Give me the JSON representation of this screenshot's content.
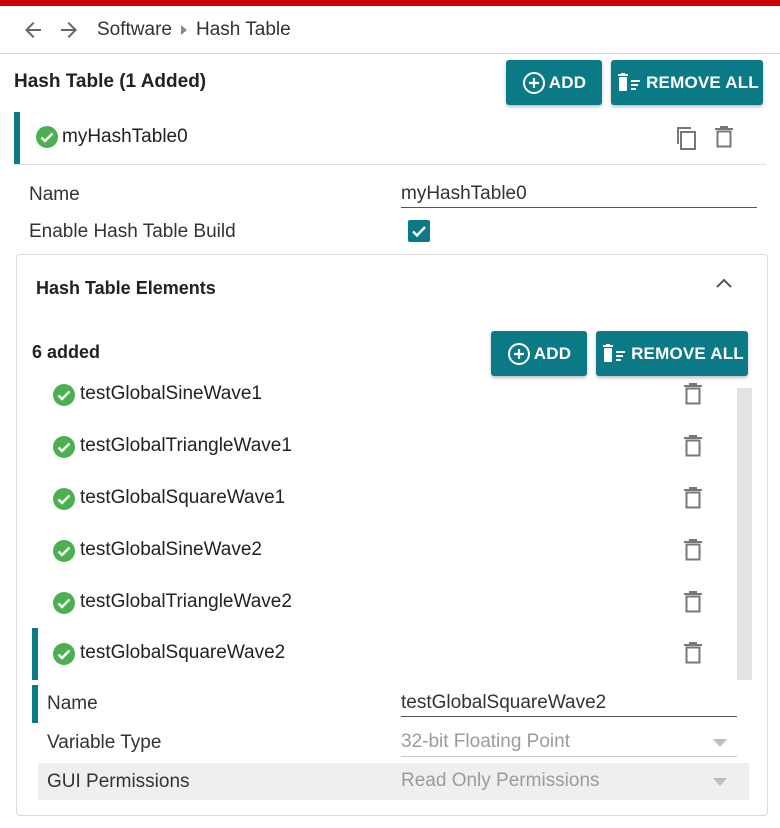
{
  "breadcrumb": {
    "items": [
      "Software",
      "Hash Table"
    ]
  },
  "header": {
    "title": "Hash Table (1 Added)",
    "add_label": "ADD",
    "remove_all_label": "REMOVE ALL"
  },
  "instance": {
    "name": "myHashTable0",
    "fields": {
      "name_label": "Name",
      "name_value": "myHashTable0",
      "enable_label": "Enable Hash Table Build",
      "enable_checked": true
    }
  },
  "elements_section": {
    "title": "Hash Table Elements",
    "count_label": "6 added",
    "add_label": "ADD",
    "remove_all_label": "REMOVE ALL",
    "items": [
      "testGlobalSineWave1",
      "testGlobalTriangleWave1",
      "testGlobalSquareWave1",
      "testGlobalSineWave2",
      "testGlobalTriangleWave2",
      "testGlobalSquareWave2"
    ],
    "selected_index": 5
  },
  "element_detail": {
    "name_label": "Name",
    "name_value": "testGlobalSquareWave2",
    "variable_type_label": "Variable Type",
    "variable_type_value": "32-bit Floating Point",
    "gui_permissions_label": "GUI Permissions",
    "gui_permissions_value": "Read Only Permissions"
  },
  "colors": {
    "accent": "#0b7a86",
    "top_bar": "#cc0000",
    "check_green": "#4caf50",
    "icon_gray": "#666666"
  }
}
